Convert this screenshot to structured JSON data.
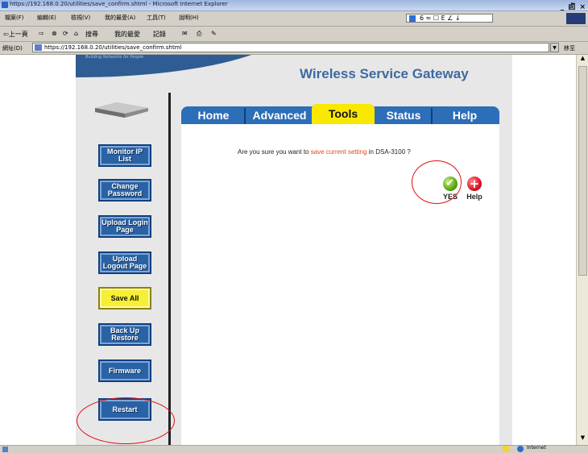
{
  "window": {
    "title": "https://192.168.0.20/utilities/save_confirm.shtml - Microsoft Internet Explorer",
    "controls": "_ 卣 ×"
  },
  "menubar": {
    "items": [
      "檔案(F)",
      "編輯(E)",
      "檢視(V)",
      "我的最愛(A)",
      "工具(T)",
      "說明(H)"
    ],
    "quick_glyphs": "6 ≈ ☐ E ∠ ↓"
  },
  "toolbar": {
    "back": "⇦上一頁",
    "forward": "⇨",
    "search": "搜尋",
    "favorites": "我的最愛",
    "history": "記錄"
  },
  "address": {
    "label": "網址(D)",
    "url": "https://192.168.0.20/utilities/save_confirm.shtml",
    "go": "移至"
  },
  "page": {
    "gateway_title": "Wireless Service Gateway",
    "tagline": "Building Networks for People",
    "sidebar_buttons": [
      "Monitor IP List",
      "Change Password",
      "Upload Login Page",
      "Upload Logout Page",
      "Save All",
      "Back Up Restore",
      "Firmware",
      "Restart"
    ],
    "tabs": [
      "Home",
      "Advanced",
      "Tools",
      "Status",
      "Help"
    ],
    "active_tab": "Tools",
    "confirm": {
      "prefix": "Are you sure you want to",
      "action": "save current setting",
      "suffix": "in DSA-3100 ?"
    },
    "yes_label": "YES",
    "help_label": "Help"
  },
  "status_bar": {
    "zone": "Internet"
  },
  "colors": {
    "tab_blue": "#2c6eb8",
    "tab_active": "#f9e800",
    "side_button": "#2a63a5",
    "save_button": "#f6ef34",
    "title_blue": "#3d6aa0",
    "highlight_ring": "#e01010"
  }
}
